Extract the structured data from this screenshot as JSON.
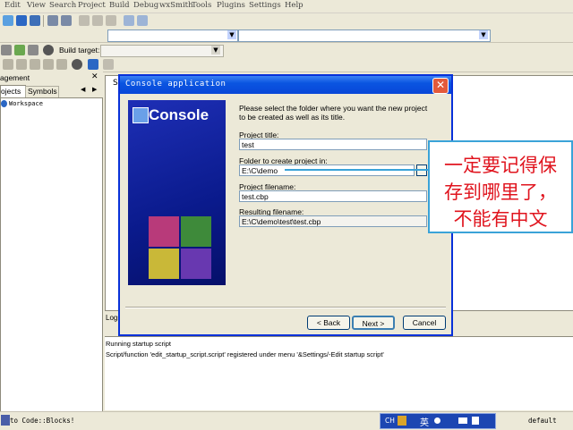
{
  "menu": [
    "Edit",
    "View",
    "Search",
    "Project",
    "Build",
    "Debug",
    "wxSmith",
    "Tools",
    "Plugins",
    "Settings",
    "Help"
  ],
  "toolbar": {
    "build_target_label": "Build target:"
  },
  "left_panel": {
    "header": "agement",
    "close_glyph": "✕",
    "tabs": [
      "ojects",
      "Symbols"
    ],
    "tab_nav": [
      "◀",
      "▶"
    ],
    "workspace_label": "Workspace"
  },
  "editor": {
    "tab_partial": "S"
  },
  "logs": {
    "header": "Logs",
    "lines": [
      "Running startup script",
      "Script/function 'edit_startup_script.script' registered under menu '&Settings/-Edit startup script'"
    ]
  },
  "dialog": {
    "title": "Console application",
    "close_glyph": "✕",
    "banner_title": "Console",
    "intro": [
      "Please select the folder where you want the new project",
      "to be created as well as its title."
    ],
    "fields": {
      "project_title_label": "Project title:",
      "project_title_value": "test",
      "folder_label": "Folder to create project in:",
      "folder_value": "E:\\C\\demo",
      "browse_label": "...",
      "filename_label": "Project filename:",
      "filename_value": "test.cbp",
      "resulting_label": "Resulting filename:",
      "resulting_value": "E:\\C\\demo\\test\\test.cbp"
    },
    "buttons": {
      "back": "< Back",
      "next": "Next >",
      "cancel": "Cancel"
    }
  },
  "annotation": {
    "lines": [
      "一定要记得保",
      "存到哪里了，",
      "不能有中文"
    ]
  },
  "status": {
    "left": "to Code::Blocks!",
    "ime": "CH",
    "ime_mode": "英",
    "right": "default"
  },
  "colors": {
    "titlebar": "#0a55e1",
    "annotation_text": "#e0141e",
    "annotation_border": "#3aa3d8"
  }
}
